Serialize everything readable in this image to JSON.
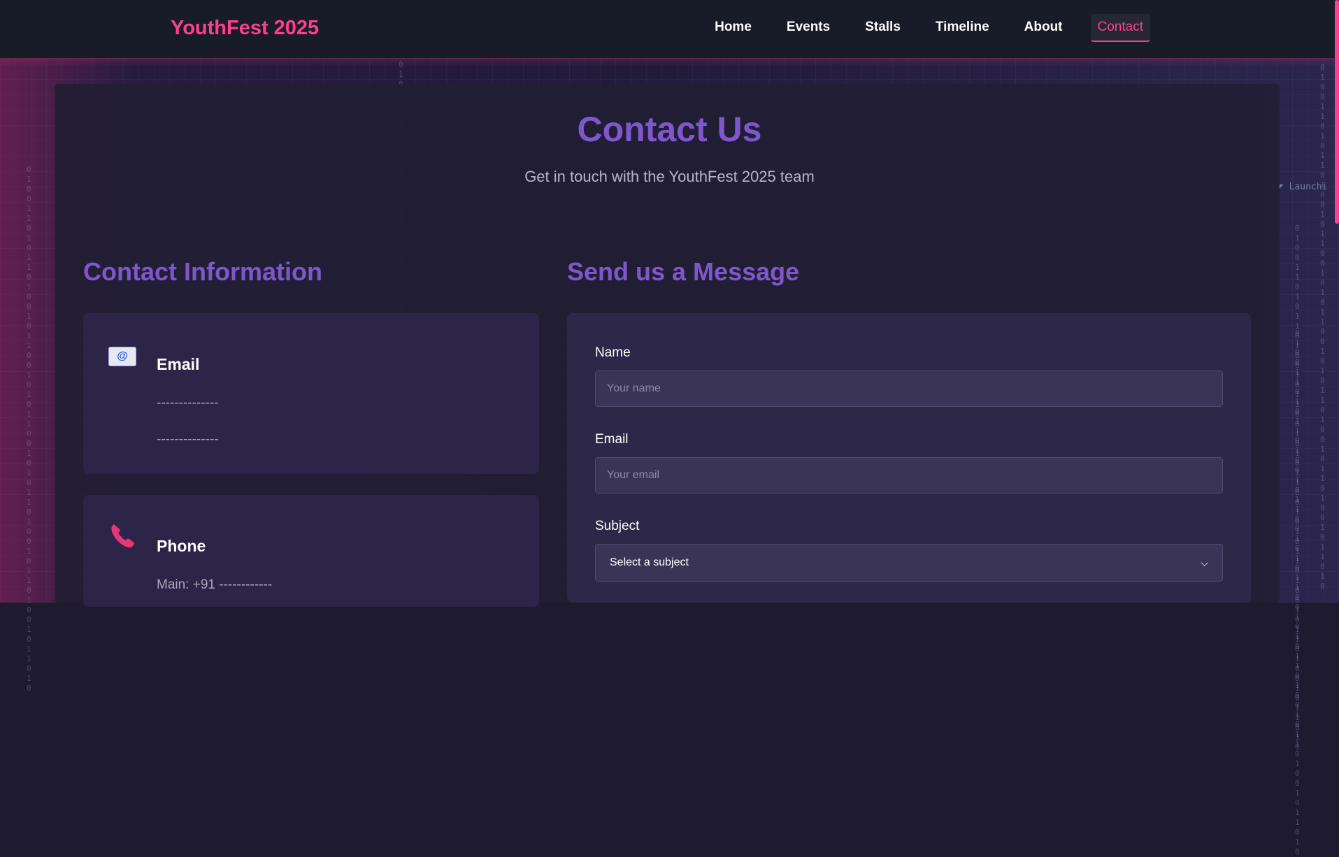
{
  "header": {
    "brand": "YouthFest 2025",
    "nav": [
      {
        "label": "Home"
      },
      {
        "label": "Events"
      },
      {
        "label": "Stalls"
      },
      {
        "label": "Timeline"
      },
      {
        "label": "About"
      },
      {
        "label": "Contact",
        "active": true
      }
    ]
  },
  "decor": {
    "launch_text": "Launchi",
    "binary": "010011010110100101100101011001010110100101101001011010"
  },
  "hero": {
    "title": "Contact Us",
    "subtitle": "Get in touch with the YouthFest 2025 team"
  },
  "contact_info": {
    "heading": "Contact Information",
    "email": {
      "icon": "email-icon",
      "title": "Email",
      "lines": [
        "--------------",
        "--------------"
      ]
    },
    "phone": {
      "icon": "phone-icon",
      "title": "Phone",
      "lines": [
        "Main: +91 ------------"
      ]
    }
  },
  "form": {
    "heading": "Send us a Message",
    "name_label": "Name",
    "name_placeholder": "Your name",
    "email_label": "Email",
    "email_placeholder": "Your email",
    "subject_label": "Subject",
    "subject_selected": "Select a subject"
  },
  "colors": {
    "accent_pink": "#ff3f8e",
    "accent_purple": "#7f57cc",
    "topbar": "#181b28"
  }
}
